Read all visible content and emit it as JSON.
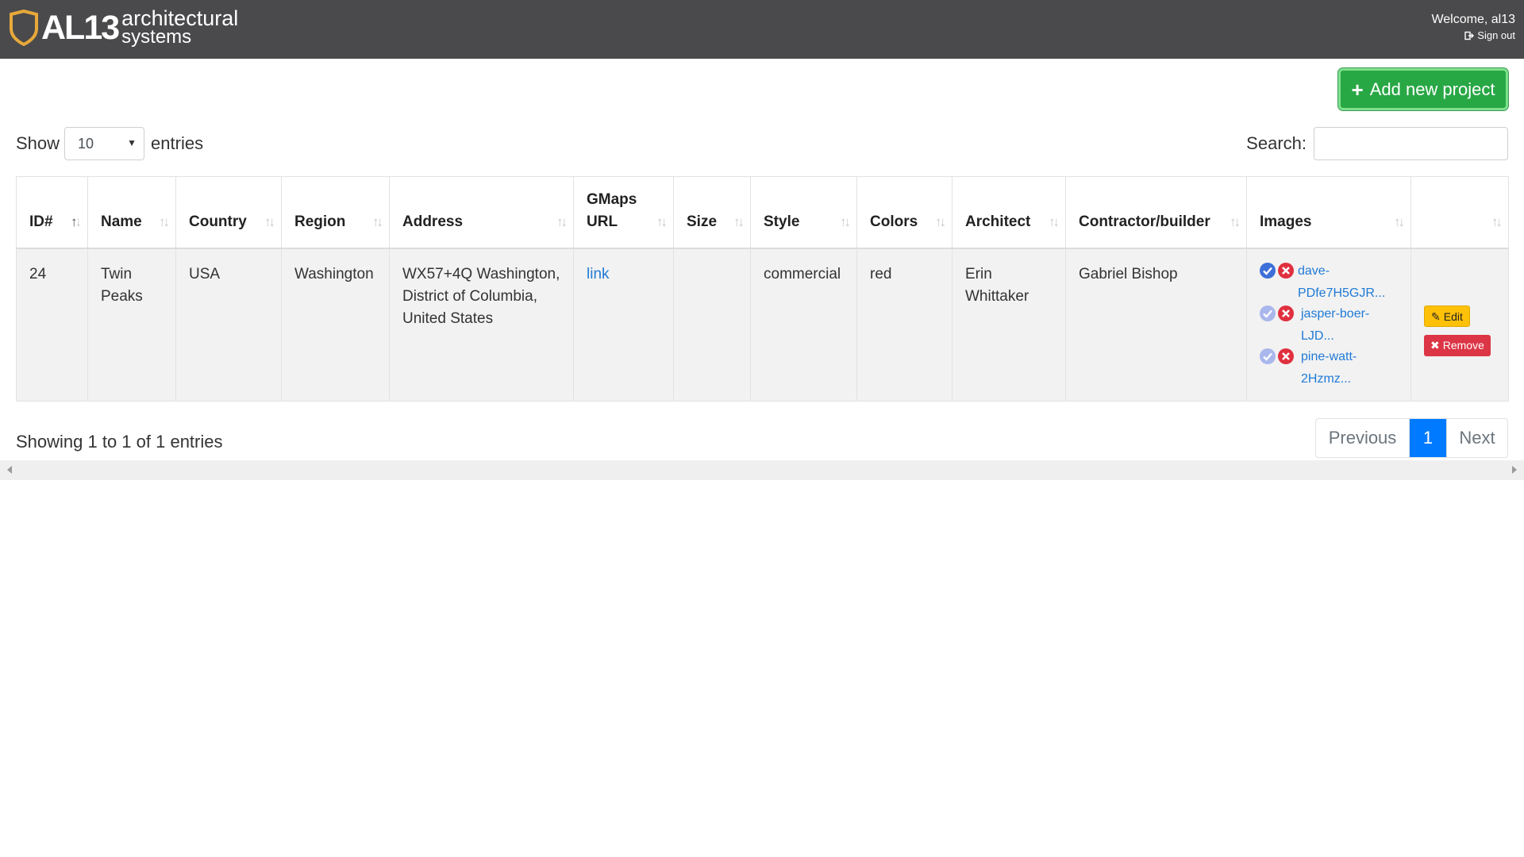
{
  "header": {
    "logo_mark": "AL13",
    "logo_line1": "architectural",
    "logo_line2": "systems",
    "welcome": "Welcome, al13",
    "signout": "Sign out",
    "logo_color": "#e8a93a"
  },
  "toolbar": {
    "add_project": "Add new project",
    "add_color": "#28a745"
  },
  "length_menu": {
    "show": "Show",
    "selected": "10",
    "entries": "entries"
  },
  "search": {
    "label": "Search:",
    "value": "",
    "placeholder": ""
  },
  "table": {
    "columns": [
      {
        "label": "ID#",
        "sorted": "asc"
      },
      {
        "label": "Name"
      },
      {
        "label": "Country"
      },
      {
        "label": "Region"
      },
      {
        "label": "Address"
      },
      {
        "label": "GMaps URL"
      },
      {
        "label": "Size"
      },
      {
        "label": "Style"
      },
      {
        "label": "Colors"
      },
      {
        "label": "Architect"
      },
      {
        "label": "Contractor/builder"
      },
      {
        "label": "Images"
      },
      {
        "label": ""
      }
    ],
    "rows": [
      {
        "id": "24",
        "name": "Twin Peaks",
        "country": "USA",
        "region": "Washington",
        "address": "WX57+4Q Washington, District of Columbia, United States",
        "gmaps": "link",
        "size": "",
        "style": "commercial",
        "colors": "red",
        "architect": "Erin Whittaker",
        "contractor": "Gabriel Bishop",
        "images": [
          {
            "line1": "dave-",
            "line2": "PDfe7H5GJR...",
            "approved": true
          },
          {
            "line1": "jasper-boer-",
            "line2": "LJD...",
            "approved": false
          },
          {
            "line1": "pine-watt-",
            "line2": "2Hzmz...",
            "approved": false
          }
        ],
        "edit": "Edit",
        "remove": "Remove"
      }
    ]
  },
  "footer": {
    "info": "Showing 1 to 1 of 1 entries",
    "previous": "Previous",
    "current": "1",
    "next": "Next"
  }
}
